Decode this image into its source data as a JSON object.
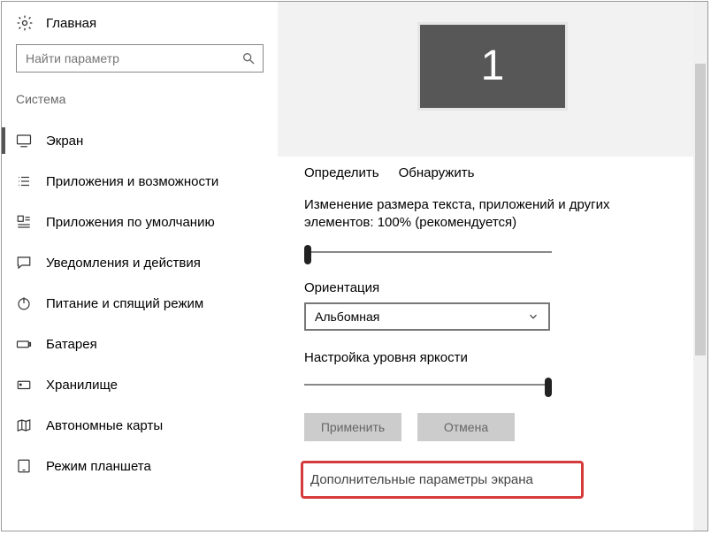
{
  "header": {
    "home": "Главная"
  },
  "search": {
    "placeholder": "Найти параметр"
  },
  "category": "Система",
  "nav": [
    {
      "label": "Экран"
    },
    {
      "label": "Приложения и возможности"
    },
    {
      "label": "Приложения по умолчанию"
    },
    {
      "label": "Уведомления и действия"
    },
    {
      "label": "Питание и спящий режим"
    },
    {
      "label": "Батарея"
    },
    {
      "label": "Хранилище"
    },
    {
      "label": "Автономные карты"
    },
    {
      "label": "Режим планшета"
    }
  ],
  "display": {
    "monitor_id": "1",
    "identify": "Определить",
    "detect": "Обнаружить",
    "scale_label": "Изменение размера текста, приложений и других элементов: 100% (рекомендуется)",
    "orientation_label": "Ориентация",
    "orientation_value": "Альбомная",
    "brightness_label": "Настройка уровня яркости",
    "apply": "Применить",
    "cancel": "Отмена",
    "advanced": "Дополнительные параметры экрана"
  }
}
